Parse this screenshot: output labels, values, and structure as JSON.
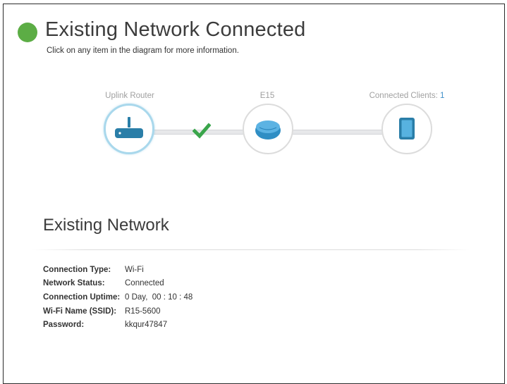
{
  "header": {
    "title": "Existing Network Connected",
    "subtitle": "Click on any item in the diagram for more information.",
    "status_color": "#5cad45"
  },
  "diagram": {
    "nodes": [
      {
        "label": "Uplink Router",
        "icon": "router-icon"
      },
      {
        "label": "E15",
        "icon": "extender-device-icon"
      },
      {
        "label": "Connected Clients: ",
        "count": "1",
        "icon": "tablet-icon"
      }
    ],
    "link_status_icon": "checkmark-icon",
    "accent_color": "#3f8fc9",
    "check_color": "#3aa54b"
  },
  "section": {
    "title": "Existing Network"
  },
  "info": [
    {
      "key": "Connection Type:",
      "value": "Wi-Fi"
    },
    {
      "key": "Network Status:",
      "value": "Connected"
    },
    {
      "key": "Connection Uptime:",
      "value": "0 Day,  00 : 10 : 48"
    },
    {
      "key": "Wi-Fi Name (SSID):",
      "value": "R15-5600"
    },
    {
      "key": "Password:",
      "value": "kkqur47847"
    }
  ]
}
